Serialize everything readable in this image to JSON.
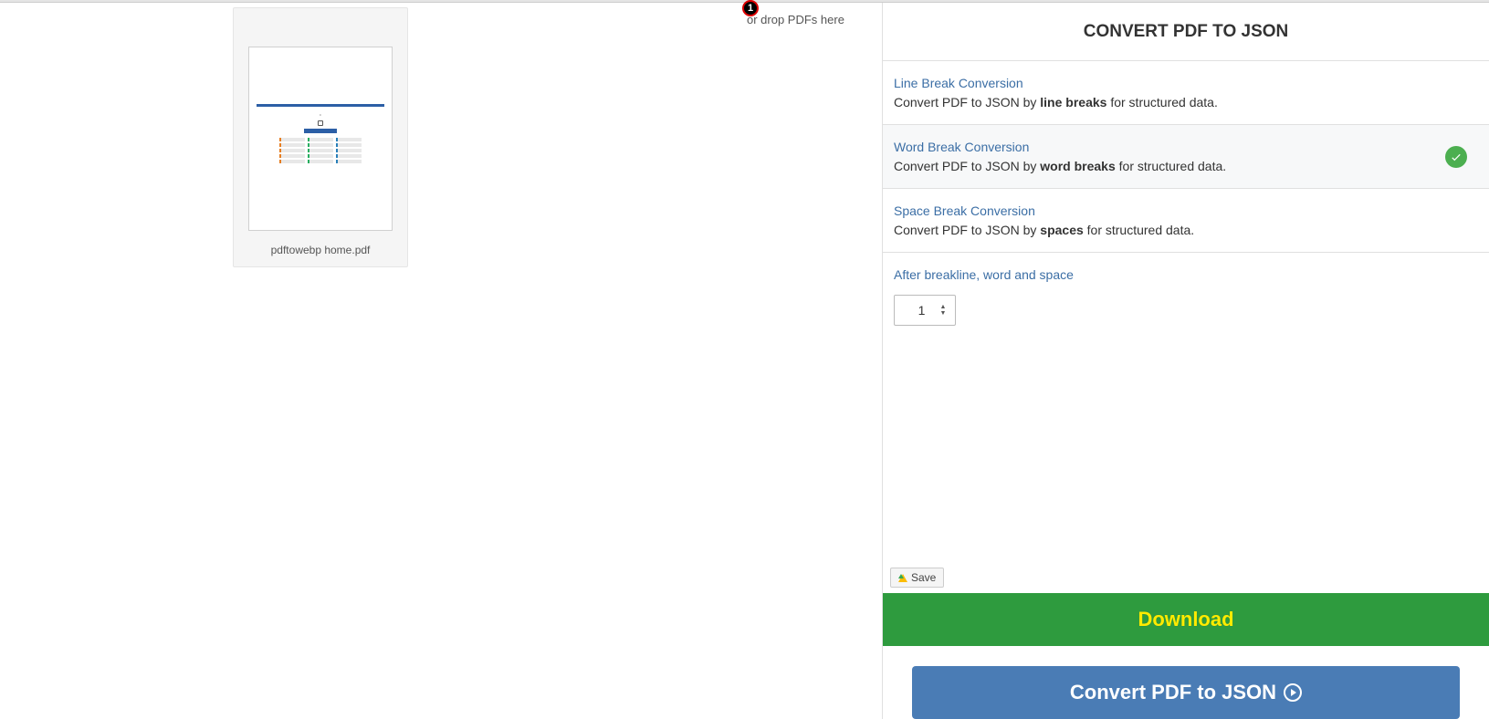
{
  "dropzone": {
    "hint": "or drop PDFs here",
    "badge": "1"
  },
  "file": {
    "name": "pdftowebp home.pdf"
  },
  "panel": {
    "title": "CONVERT PDF TO JSON",
    "options": [
      {
        "title": "Line Break Conversion",
        "desc_pre": "Convert PDF to JSON by ",
        "desc_bold": "line breaks",
        "desc_post": " for structured data.",
        "selected": false
      },
      {
        "title": "Word Break Conversion",
        "desc_pre": "Convert PDF to JSON by ",
        "desc_bold": "word breaks",
        "desc_post": " for structured data.",
        "selected": true
      },
      {
        "title": "Space Break Conversion",
        "desc_pre": "Convert PDF to JSON by ",
        "desc_bold": "spaces",
        "desc_post": " for structured data.",
        "selected": false
      }
    ],
    "breakline": {
      "label": "After breakline, word and space",
      "value": "1"
    },
    "save_label": "Save",
    "download_label": "Download",
    "convert_label": "Convert PDF to JSON"
  }
}
